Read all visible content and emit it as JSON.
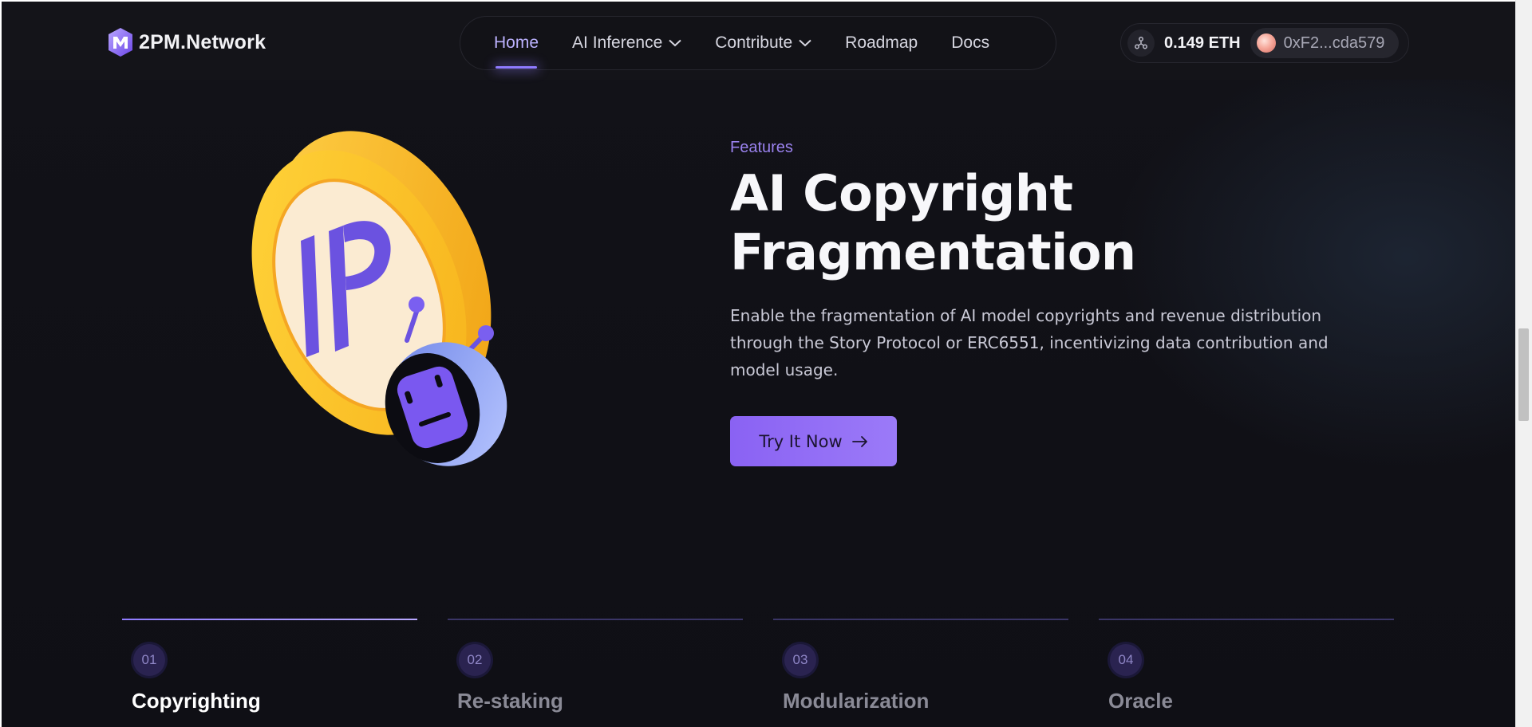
{
  "header": {
    "brand": "2PM.Network",
    "nav": [
      {
        "label": "Home",
        "active": true,
        "has_dropdown": false
      },
      {
        "label": "AI Inference",
        "active": false,
        "has_dropdown": true
      },
      {
        "label": "Contribute",
        "active": false,
        "has_dropdown": true
      },
      {
        "label": "Roadmap",
        "active": false,
        "has_dropdown": false
      },
      {
        "label": "Docs",
        "active": false,
        "has_dropdown": false
      }
    ],
    "wallet": {
      "network_icon": "network-icon",
      "balance": "0.149 ETH",
      "address": "0xF2...cda579"
    }
  },
  "hero": {
    "eyebrow": "Features",
    "title": "AI Copyright Fragmentation",
    "description": "Enable the fragmentation of AI model copyrights and revenue distribution through the Story Protocol or ERC6551, incentivizing data contribution and model usage.",
    "cta_label": "Try It Now",
    "illustration_text": "IP"
  },
  "feature_tabs": [
    {
      "number": "01",
      "title": "Copyrighting",
      "active": true
    },
    {
      "number": "02",
      "title": "Re-staking",
      "active": false
    },
    {
      "number": "03",
      "title": "Modularization",
      "active": false
    },
    {
      "number": "04",
      "title": "Oracle",
      "active": false
    }
  ],
  "colors": {
    "background": "#121218",
    "accent": "#8f7bff",
    "cta": "#8a62f3",
    "coin_gold": "#f7b81b"
  }
}
